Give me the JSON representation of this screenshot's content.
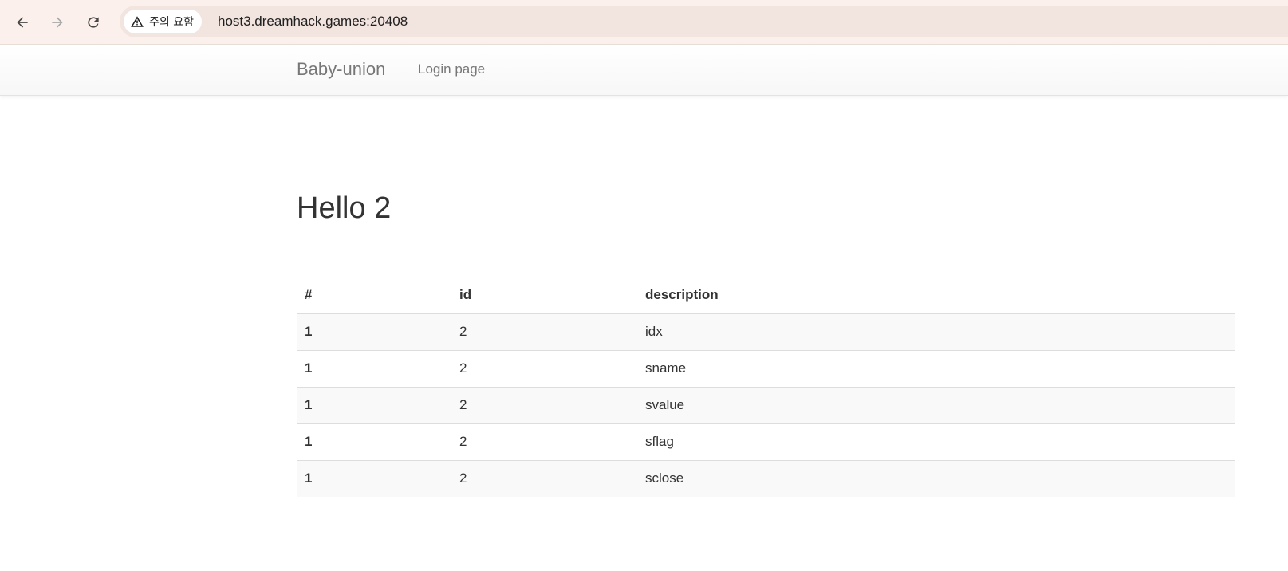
{
  "browser": {
    "security_label": "주의 요함",
    "url": "host3.dreamhack.games:20408",
    "icons": {
      "back": "arrow-left-icon",
      "forward": "arrow-right-icon",
      "reload": "reload-icon",
      "security": "warning-triangle-icon"
    }
  },
  "navbar": {
    "brand": "Baby-union",
    "links": [
      {
        "label": "Login page"
      }
    ]
  },
  "main": {
    "title": "Hello 2",
    "table": {
      "headers": [
        "#",
        "id",
        "description"
      ],
      "rows": [
        [
          "1",
          "2",
          "idx"
        ],
        [
          "1",
          "2",
          "sname"
        ],
        [
          "1",
          "2",
          "svalue"
        ],
        [
          "1",
          "2",
          "sflag"
        ],
        [
          "1",
          "2",
          "sclose"
        ]
      ]
    }
  }
}
